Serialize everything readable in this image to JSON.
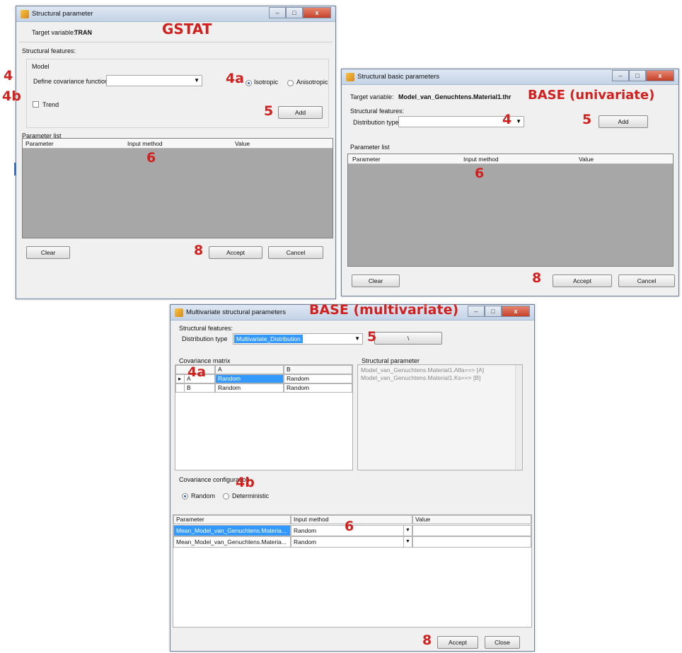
{
  "annotations": {
    "gstat_label": "GSTAT",
    "base_uni_label": "BASE (univariate)",
    "base_multi_label": "BASE (multivariate)",
    "g_4": "4",
    "g_4a": "4a",
    "g_4b": "4b",
    "g_5": "5",
    "g_6": "6",
    "g_8": "8",
    "u_4": "4",
    "u_5": "5",
    "u_6": "6",
    "u_8": "8",
    "m_5": "5",
    "m_4a": "4a",
    "m_4b": "4b",
    "m_6": "6",
    "m_8": "8"
  },
  "window_buttons": {
    "minimize": "–",
    "maximize": "□",
    "close": "x"
  },
  "gstat": {
    "title": "Structural parameter",
    "target_label": "Target variable:",
    "target_value": "TRAN",
    "structural_features": "Structural features:",
    "model": "Model",
    "define_covariance": "Define covariance function:",
    "isotropic": "Isotropic",
    "anisotropic": "Anisotropic",
    "trend": "Trend",
    "add": "Add",
    "parameter_list": "Parameter list",
    "columns": [
      "Parameter",
      "Input method",
      "Value"
    ],
    "clear": "Clear",
    "accept": "Accept",
    "cancel": "Cancel"
  },
  "base_uni": {
    "title": "Structural basic parameters",
    "target_label": "Target variable:",
    "target_value": "Model_van_Genuchtens.Material1.thr",
    "structural_features": "Structural features:",
    "distribution_type": "Distribution type",
    "add": "Add",
    "parameter_list": "Parameter list",
    "columns": [
      "Parameter",
      "Input method",
      "Value"
    ],
    "clear": "Clear",
    "accept": "Accept",
    "cancel": "Cancel"
  },
  "base_multi": {
    "title": "Multivariate structural parameters",
    "structural_features": "Structural features:",
    "distribution_type": "Distribution type",
    "distribution_value": "Multivariate_Distribution",
    "button_glyph": "\\",
    "covariance_matrix": "Covariance matrix",
    "matrix_cols": [
      "A",
      "B"
    ],
    "matrix_rows": [
      {
        "name": "A",
        "a": "Random",
        "b": "Random"
      },
      {
        "name": "B",
        "a": "Random",
        "b": "Random"
      }
    ],
    "structural_parameter": "Structural parameter",
    "structural_lines": [
      "Model_van_Genuchtens.Material1.Alfa==>  [A]",
      "Model_van_Genuchtens.Material1.Ks==>  [B]"
    ],
    "covariance_configuration": "Covariance configuration",
    "random": "Random",
    "deterministic": "Deterministic",
    "param_columns": [
      "Parameter",
      "Input method",
      "Value"
    ],
    "param_rows": [
      {
        "parameter": "Mean_Model_van_Genuchtens.Materia...",
        "method": "Random",
        "value": ""
      },
      {
        "parameter": "Mean_Model_van_Genuchtens.Materia...",
        "method": "Random",
        "value": ""
      }
    ],
    "accept": "Accept",
    "close": "Close"
  }
}
